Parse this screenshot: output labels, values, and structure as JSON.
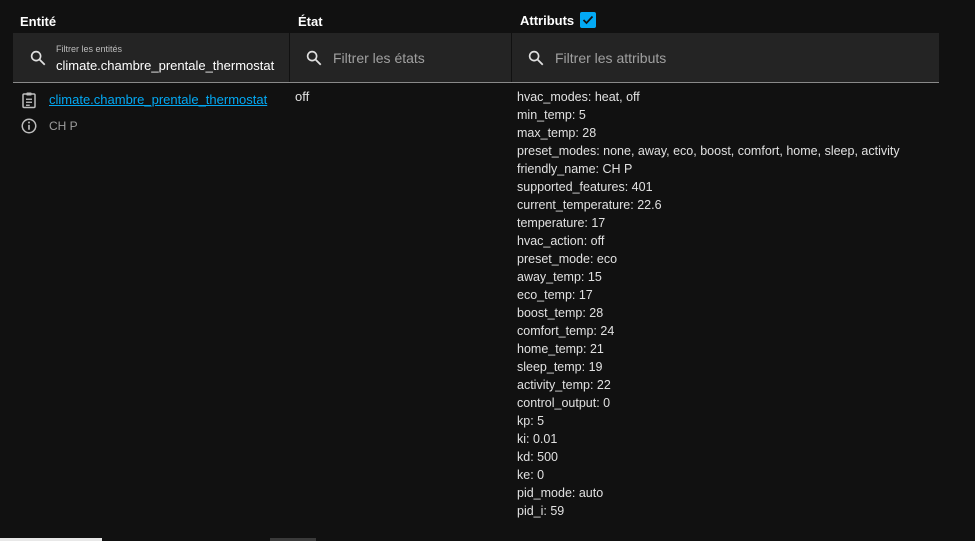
{
  "headers": {
    "entity": "Entité",
    "state": "État",
    "attributes": "Attributs",
    "attributes_checked": true
  },
  "filters": {
    "entity_label": "Filtrer les entités",
    "entity_value": "climate.chambre_prentale_thermostat",
    "state_placeholder": "Filtrer les états",
    "attr_placeholder": "Filtrer les attributs"
  },
  "row": {
    "entity_id": "climate.chambre_prentale_thermostat",
    "friendly_name": "CH P",
    "state": "off",
    "attributes": [
      "hvac_modes: heat, off",
      "min_temp: 5",
      "max_temp: 28",
      "preset_modes: none, away, eco, boost, comfort, home, sleep, activity",
      "friendly_name: CH P",
      "supported_features: 401",
      "current_temperature: 22.6",
      "temperature: 17",
      "hvac_action: off",
      "preset_mode: eco",
      "away_temp: 15",
      "eco_temp: 17",
      "boost_temp: 28",
      "comfort_temp: 24",
      "home_temp: 21",
      "sleep_temp: 19",
      "activity_temp: 22",
      "control_output: 0",
      "kp: 5",
      "ki: 0.01",
      "kd: 500",
      "ke: 0",
      "pid_mode: auto",
      "pid_i: 59"
    ]
  },
  "icons": {
    "search": "search-icon",
    "clipboard": "clipboard-icon",
    "info": "info-icon",
    "check": "check-icon"
  },
  "colors": {
    "background": "#111111",
    "filter_bg": "#242424",
    "accent": "#03a9f4",
    "text": "#e1e1e1",
    "muted": "#9e9e9e"
  }
}
